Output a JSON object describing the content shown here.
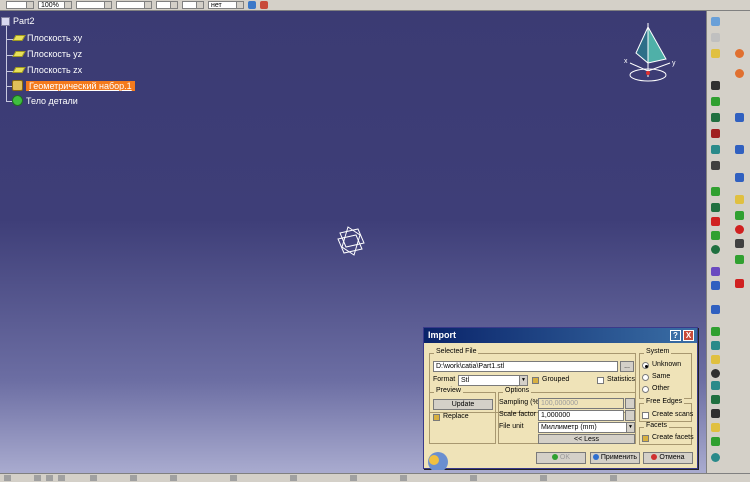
{
  "toolbar": {
    "zoom_value": "100%",
    "layer_value": "нет"
  },
  "tree": {
    "root": "Part2",
    "items": [
      {
        "label": "Плоскость xy"
      },
      {
        "label": "Плоскость yz"
      },
      {
        "label": "Плоскость zx"
      },
      {
        "label": "Геометрический набор.1"
      },
      {
        "label": "Тело детали"
      }
    ]
  },
  "compass": {
    "x_label": "x",
    "y_label": "y"
  },
  "dialog": {
    "title": "Import",
    "help_btn": "?",
    "close_btn": "X",
    "selected_file": {
      "title": "Selected File",
      "path": "D:\\work\\catia\\Part1.stl",
      "browse": "..."
    },
    "format": {
      "label": "Format",
      "value": "Stl",
      "grouped_label": "Grouped",
      "grouped_checked": true,
      "statistics_label": "Statistics",
      "statistics_checked": false
    },
    "system": {
      "title": "System",
      "options": [
        "Unknown",
        "Same",
        "Other"
      ],
      "selected": "Unknown"
    },
    "preview": {
      "title": "Preview",
      "update": "Update",
      "replace_label": "Replace",
      "replace_checked": true
    },
    "options": {
      "title": "Options",
      "sampling_label": "Sampling (%)",
      "sampling_value": "100,000000",
      "scale_label": "Scale factor",
      "scale_value": "1,000000",
      "unit_label": "File unit",
      "unit_value": "Миллиметр (mm)",
      "less_btn": "<< Less"
    },
    "free_edges": {
      "title": "Free Edges",
      "create_scans_label": "Create scans",
      "create_scans_checked": false
    },
    "facets": {
      "title": "Facets",
      "create_facets_label": "Create facets",
      "create_facets_checked": true
    },
    "buttons": {
      "ok": "OK",
      "apply": "Применить",
      "cancel": "Отмена"
    }
  }
}
